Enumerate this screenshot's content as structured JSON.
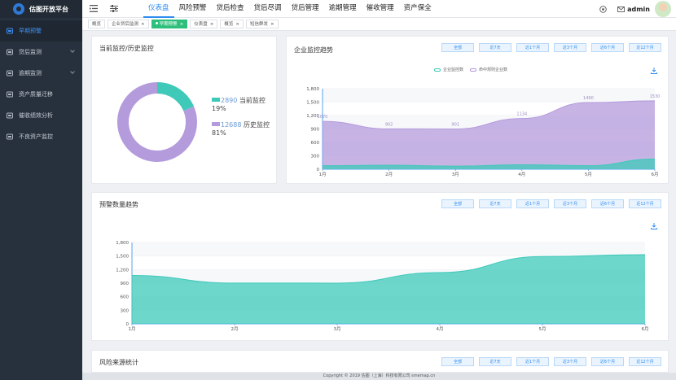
{
  "brand": {
    "title": "估图开放平台"
  },
  "sidebar": {
    "items": [
      {
        "label": "早期预警",
        "icon": "dashboard-icon",
        "active": true,
        "arrow": false
      },
      {
        "label": "贷后监测",
        "icon": "monitor-icon",
        "active": false,
        "arrow": true
      },
      {
        "label": "逾期监测",
        "icon": "calendar-icon",
        "active": false,
        "arrow": true
      },
      {
        "label": "资产质量迁移",
        "icon": "list-icon",
        "active": false,
        "arrow": false
      },
      {
        "label": "催收绩效分析",
        "icon": "cart-icon",
        "active": false,
        "arrow": false
      },
      {
        "label": "不良资产监控",
        "icon": "screen-icon",
        "active": false,
        "arrow": false
      }
    ]
  },
  "header": {
    "menu": [
      "仪表盘",
      "风险预警",
      "贷后检查",
      "贷后尽调",
      "贷后管理",
      "逾期管理",
      "催收管理",
      "资产保全"
    ],
    "active_index": 0,
    "user": "admin"
  },
  "tabs": [
    {
      "label": "概览",
      "active": false,
      "dot": false,
      "close": false
    },
    {
      "label": "企业贷后监测",
      "active": false,
      "dot": false,
      "close": true
    },
    {
      "label": "早期预警",
      "active": true,
      "dot": true,
      "close": true
    },
    {
      "label": "仪表盘",
      "active": false,
      "dot": false,
      "close": true
    },
    {
      "label": "概览",
      "active": false,
      "dot": false,
      "close": true
    },
    {
      "label": "短信群发",
      "active": false,
      "dot": false,
      "close": true
    }
  ],
  "range_buttons": [
    "全部",
    "近7天",
    "近1个月",
    "近3个月",
    "近6个月",
    "近12个月"
  ],
  "donut_panel": {
    "title": "当前监控/历史监控",
    "items": [
      {
        "value": "2890",
        "label": "当前监控",
        "percent": "19%",
        "fraction": 0.186,
        "color": "#3ec9b9"
      },
      {
        "value": "12688",
        "label": "历史监控",
        "percent": "81%",
        "fraction": 0.814,
        "color": "#b49bdc"
      }
    ]
  },
  "trend_panel": {
    "title": "企业监控趋势"
  },
  "warning_panel": {
    "title": "预警数量趋势"
  },
  "source_panel": {
    "title": "风险来源统计"
  },
  "colors": {
    "accent": "#2d8cf0",
    "teal": "#3ec9b9",
    "purple": "#b49bdc",
    "tab_active": "#2fbf7c",
    "sidebar_bg": "#27313d"
  },
  "chart_data": [
    {
      "type": "area",
      "x": [
        "1月",
        "2月",
        "3月",
        "4月",
        "5月",
        "6月"
      ],
      "ylim": [
        0,
        1800
      ],
      "yticks": [
        "0",
        "300",
        "600",
        "900",
        "1,200",
        "1,500",
        "1,800"
      ],
      "series": [
        {
          "name": "企业监控数",
          "values": [
            80,
            90,
            70,
            100,
            80,
            230
          ],
          "color": "#3ec9b9"
        },
        {
          "name": "命中规则企业数",
          "values": [
            1070,
            902,
            901,
            1134,
            1490,
            1530
          ],
          "color": "#b49bdc",
          "labels": [
            "1070",
            "902",
            "901",
            "1134",
            "1490",
            "1530"
          ]
        }
      ]
    },
    {
      "type": "area",
      "x": [
        "1月",
        "2月",
        "3月",
        "4月",
        "5月",
        "6月"
      ],
      "ylim": [
        0,
        1800
      ],
      "yticks": [
        "0",
        "300",
        "600",
        "900",
        "1,200",
        "1,500",
        "1,800"
      ],
      "series": [
        {
          "values": [
            1070,
            902,
            901,
            1134,
            1490,
            1530
          ],
          "color": "#3ec9b9"
        }
      ]
    }
  ],
  "footer": "Copyright © 2019 估图（上海）科技有限公司 smemap.cn"
}
